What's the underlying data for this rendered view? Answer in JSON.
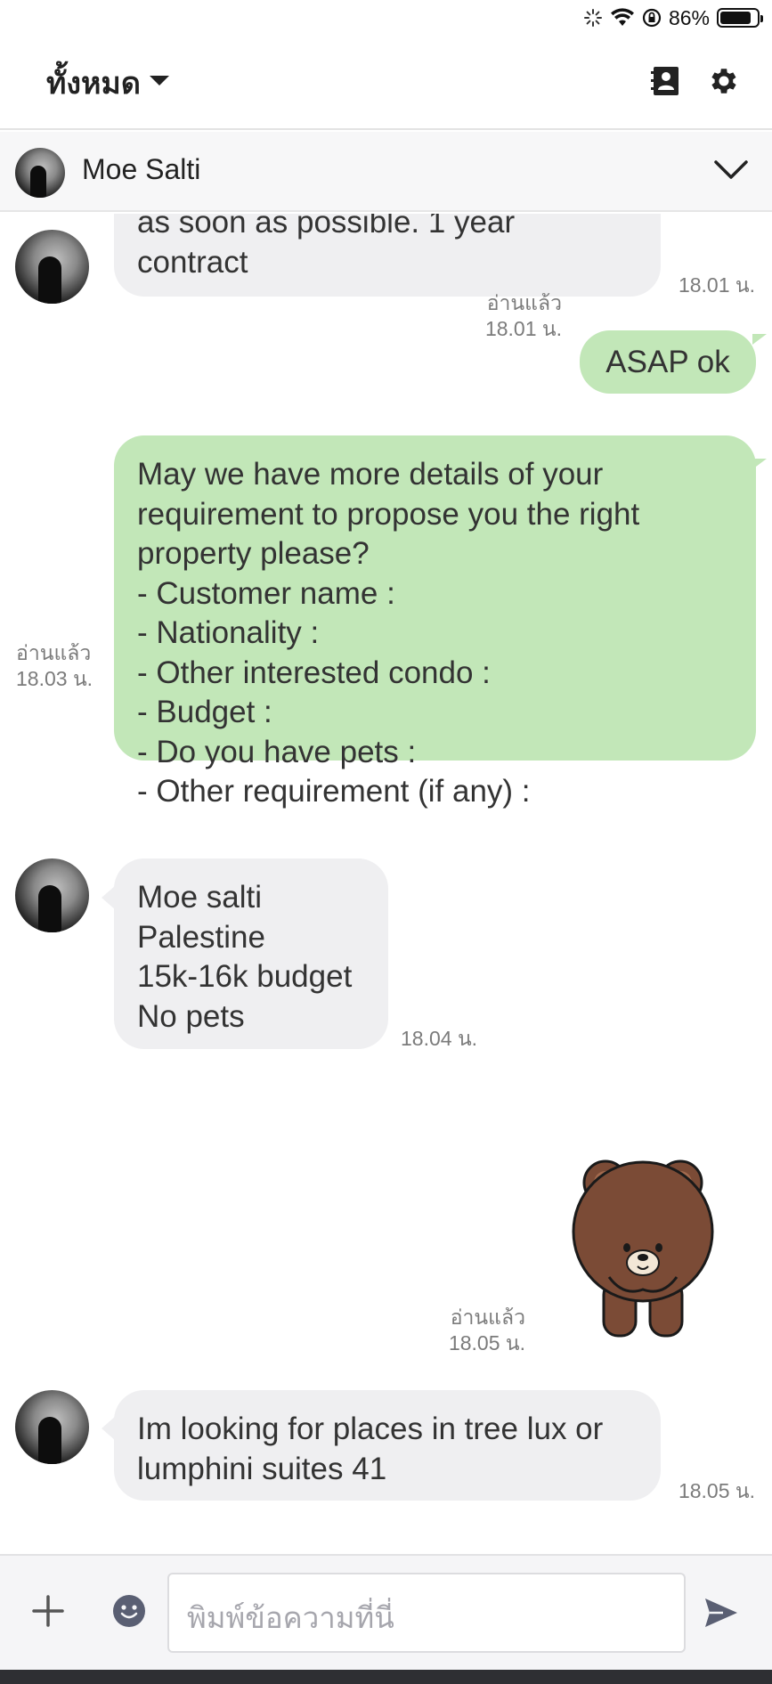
{
  "status_bar": {
    "battery_text": "86%",
    "battery_level": 0.86
  },
  "header": {
    "title": "ทั้งหมด"
  },
  "contact": {
    "name": "Moe Salti"
  },
  "messages": [
    {
      "lines": [
        "as soon as possible. 1 year",
        "contract"
      ],
      "time": "18.01 น."
    },
    {
      "text": "ASAP ok",
      "read": "อ่านแล้ว",
      "time": "18.01 น."
    },
    {
      "lines": [
        "May we have more details of your",
        "requirement to propose you the right",
        "property please?",
        "- Customer name :",
        "- Nationality :",
        "- Other interested condo :",
        "- Budget :",
        "- Do you have pets :",
        "- Other requirement (if any) :"
      ],
      "read": "อ่านแล้ว",
      "time": "18.03 น."
    },
    {
      "lines": [
        "Moe salti",
        "Palestine",
        "15k-16k budget",
        "No pets"
      ],
      "time": "18.04 น."
    },
    {
      "sticker": "brown-bear-sticker",
      "read": "อ่านแล้ว",
      "time": "18.05 น."
    },
    {
      "lines": [
        "Im looking for places in tree lux or",
        "lumphini suites 41"
      ],
      "time": "18.05 น."
    }
  ],
  "input": {
    "placeholder": "พิมพ์ข้อความที่นี่"
  },
  "icons": {
    "header_left": "caret-down-icon",
    "header_right": [
      "contacts-icon",
      "gear-icon"
    ],
    "contact_bar": "chevron-down-icon",
    "input_bar": [
      "plus-icon",
      "emoji-icon",
      "send-icon"
    ]
  },
  "colors": {
    "outgoing_bubble": "#c2e7b8",
    "incoming_bubble": "#efeff1",
    "meta_text": "#7b7b7b"
  }
}
